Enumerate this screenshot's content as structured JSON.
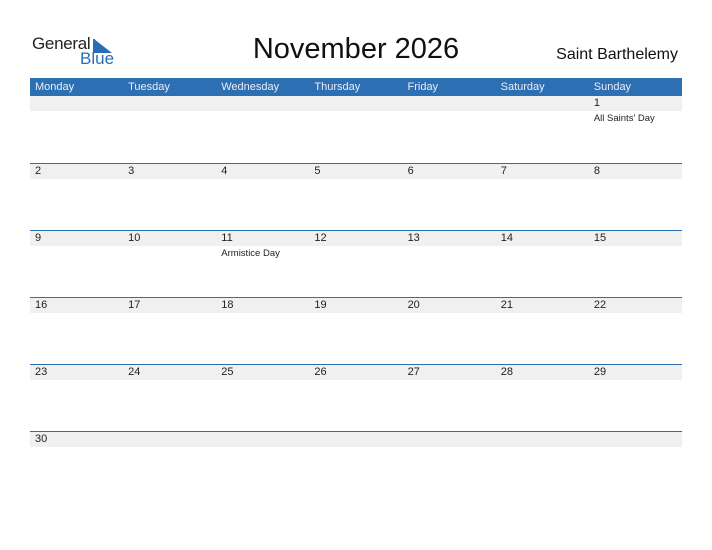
{
  "logo": {
    "word1": "General",
    "word2": "Blue",
    "accent_color": "#2b6db3"
  },
  "title": "November 2026",
  "country": "Saint Barthelemy",
  "weekdays": [
    "Monday",
    "Tuesday",
    "Wednesday",
    "Thursday",
    "Friday",
    "Saturday",
    "Sunday"
  ],
  "colors": {
    "header_bg": "#2d6fb3",
    "band_bg": "#f0f0f0"
  },
  "weeks": [
    [
      {
        "day": "",
        "event": ""
      },
      {
        "day": "",
        "event": ""
      },
      {
        "day": "",
        "event": ""
      },
      {
        "day": "",
        "event": ""
      },
      {
        "day": "",
        "event": ""
      },
      {
        "day": "",
        "event": ""
      },
      {
        "day": "1",
        "event": "All Saints' Day"
      }
    ],
    [
      {
        "day": "2",
        "event": ""
      },
      {
        "day": "3",
        "event": ""
      },
      {
        "day": "4",
        "event": ""
      },
      {
        "day": "5",
        "event": ""
      },
      {
        "day": "6",
        "event": ""
      },
      {
        "day": "7",
        "event": ""
      },
      {
        "day": "8",
        "event": ""
      }
    ],
    [
      {
        "day": "9",
        "event": ""
      },
      {
        "day": "10",
        "event": ""
      },
      {
        "day": "11",
        "event": "Armistice Day"
      },
      {
        "day": "12",
        "event": ""
      },
      {
        "day": "13",
        "event": ""
      },
      {
        "day": "14",
        "event": ""
      },
      {
        "day": "15",
        "event": ""
      }
    ],
    [
      {
        "day": "16",
        "event": ""
      },
      {
        "day": "17",
        "event": ""
      },
      {
        "day": "18",
        "event": ""
      },
      {
        "day": "19",
        "event": ""
      },
      {
        "day": "20",
        "event": ""
      },
      {
        "day": "21",
        "event": ""
      },
      {
        "day": "22",
        "event": ""
      }
    ],
    [
      {
        "day": "23",
        "event": ""
      },
      {
        "day": "24",
        "event": ""
      },
      {
        "day": "25",
        "event": ""
      },
      {
        "day": "26",
        "event": ""
      },
      {
        "day": "27",
        "event": ""
      },
      {
        "day": "28",
        "event": ""
      },
      {
        "day": "29",
        "event": ""
      }
    ],
    [
      {
        "day": "30",
        "event": ""
      },
      {
        "day": "",
        "event": ""
      },
      {
        "day": "",
        "event": ""
      },
      {
        "day": "",
        "event": ""
      },
      {
        "day": "",
        "event": ""
      },
      {
        "day": "",
        "event": ""
      },
      {
        "day": "",
        "event": ""
      }
    ]
  ]
}
